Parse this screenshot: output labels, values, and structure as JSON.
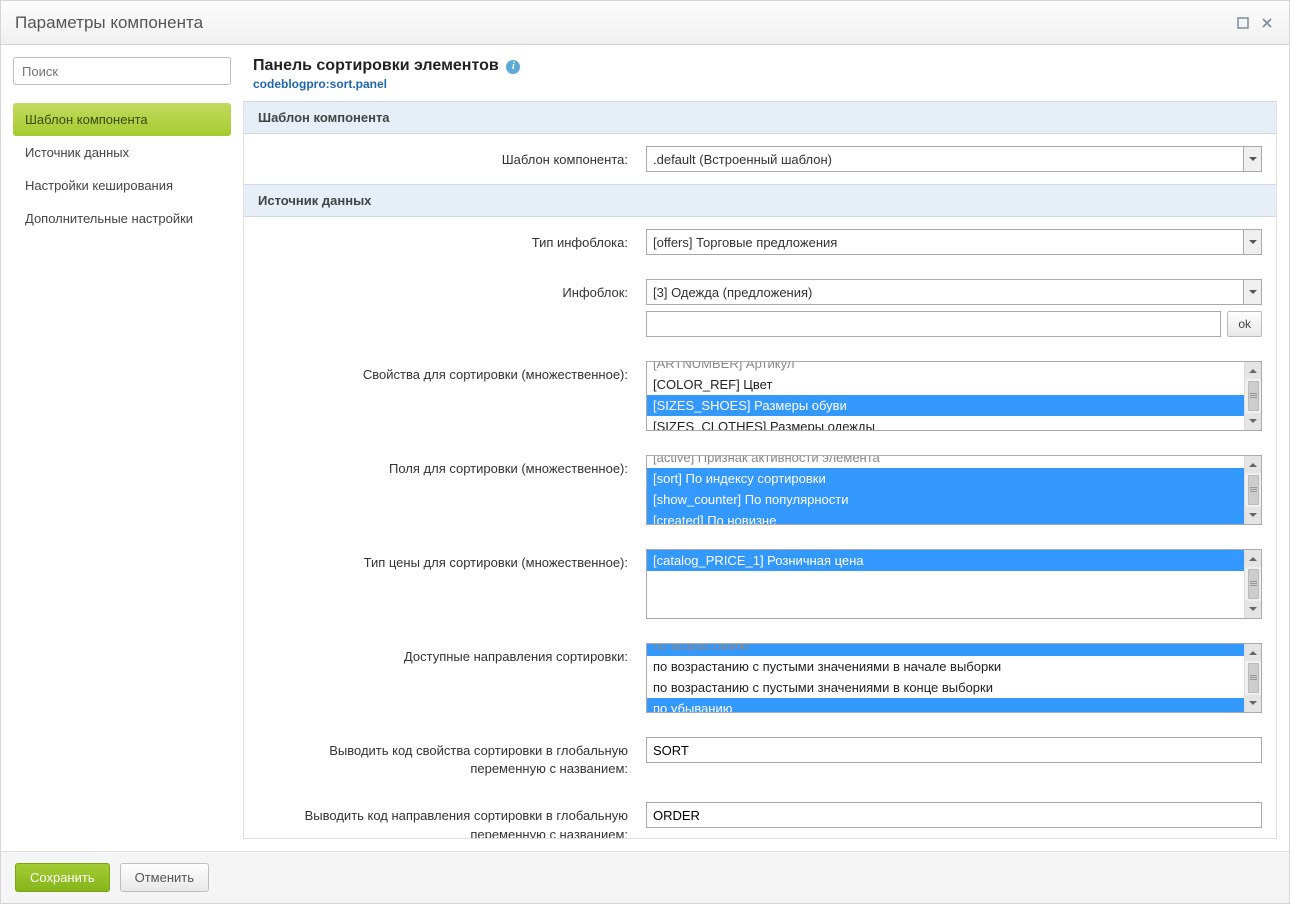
{
  "window": {
    "title": "Параметры компонента"
  },
  "sidebar": {
    "search_placeholder": "Поиск",
    "items": [
      "Шаблон компонента",
      "Источник данных",
      "Настройки кеширования",
      "Дополнительные настройки"
    ]
  },
  "header": {
    "title": "Панель сортировки элементов",
    "code": "codeblogpro:sort.panel"
  },
  "sections": {
    "template": {
      "title": "Шаблон компонента",
      "rows": {
        "template": {
          "label": "Шаблон компонента:",
          "value": ".default (Встроенный шаблон)"
        }
      }
    },
    "datasource": {
      "title": "Источник данных",
      "rows": {
        "iblock_type": {
          "label": "Тип инфоблока:",
          "value": "[offers] Торговые предложения"
        },
        "iblock": {
          "label": "Инфоблок:",
          "select_value": "[3] Одежда (предложения)",
          "input_value": "",
          "ok": "ok"
        },
        "sort_props": {
          "label": "Свойства для сортировки (множественное):",
          "options": [
            {
              "text": "[ARTNUMBER] Артикул",
              "selected": false,
              "cut": true
            },
            {
              "text": "[COLOR_REF] Цвет",
              "selected": false
            },
            {
              "text": "[SIZES_SHOES] Размеры обуви",
              "selected": true
            },
            {
              "text": "[SIZES_CLOTHES] Размеры одежды",
              "selected": false
            }
          ]
        },
        "sort_fields": {
          "label": "Поля для сортировки (множественное):",
          "options": [
            {
              "text": "[active] Признак активности элемента",
              "selected": false,
              "cut": true
            },
            {
              "text": "[sort] По индексу сортировки",
              "selected": true
            },
            {
              "text": "[show_counter] По популярности",
              "selected": true
            },
            {
              "text": "[created] По новизне",
              "selected": true
            }
          ]
        },
        "price_type": {
          "label": "Тип цены для сортировки (множественное):",
          "options": [
            {
              "text": "[catalog_PRICE_1] Розничная цена",
              "selected": true
            }
          ]
        },
        "sort_dirs": {
          "label": "Доступные направления сортировки:",
          "options": [
            {
              "text": "по возрастанию",
              "selected": true,
              "cut": true
            },
            {
              "text": "по возрастанию с пустыми значениями в начале выборки",
              "selected": false
            },
            {
              "text": "по возрастанию с пустыми значениями в конце выборки",
              "selected": false
            },
            {
              "text": "по убыванию",
              "selected": true
            }
          ]
        },
        "sort_var": {
          "label": "Выводить код свойства сортировки в глобальную переменную с названием:",
          "value": "SORT"
        },
        "order_var": {
          "label": "Выводить код направления сортировки в глобальную переменную с названием:",
          "value": "ORDER"
        }
      }
    }
  },
  "footer": {
    "save": "Сохранить",
    "cancel": "Отменить"
  }
}
